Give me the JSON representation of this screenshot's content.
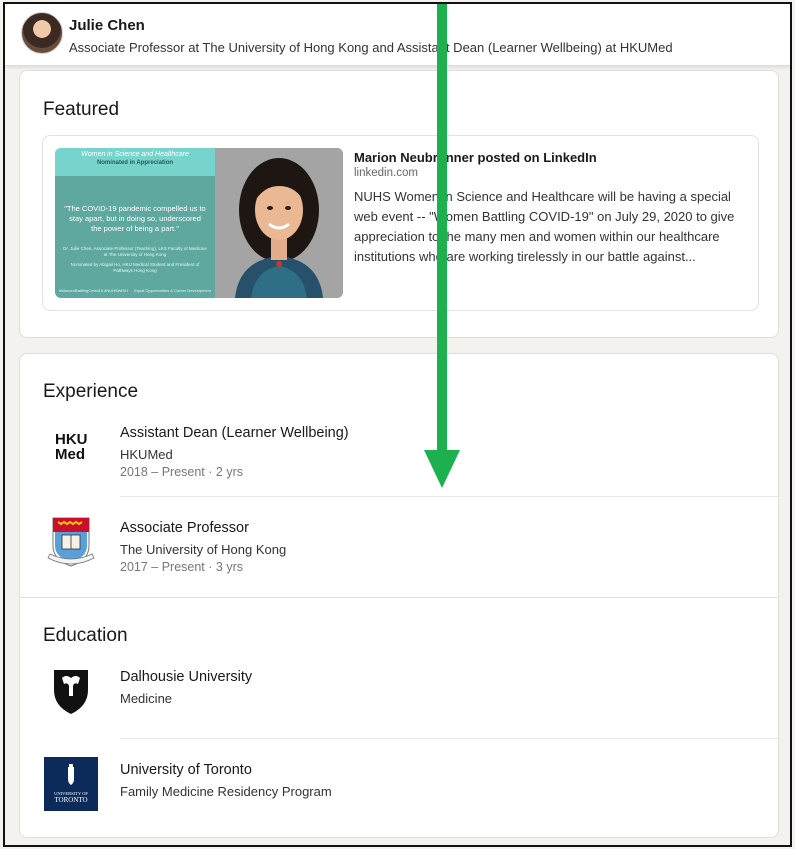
{
  "header": {
    "name": "Julie Chen",
    "headline": "Associate Professor at The University of Hong Kong and Assistant Dean (Learner Wellbeing) at HKUMed"
  },
  "featured": {
    "title": "Featured",
    "item": {
      "image_title": "Women in Science and Healthcare",
      "image_subtitle": "Nominated in Appreciation",
      "image_quote": "\"The COVID-19 pandemic compelled us to stay apart, but in doing so, underscored the power of being a part.\"",
      "image_credit": "Dr. Julie Chen, Associate Professor (Teaching), LKS Faculty of Medicine at The University of Hong Kong",
      "image_nominated": "Nominated by Abigail Ho, HKU Medical Student and President of Pathways Hong Kong",
      "image_tags": "#WomenBattlingCovid19 #NUHSWiSH",
      "image_eo": "Equal Opportunities & Career Development",
      "author_line": "Marion Neubronner posted on LinkedIn",
      "domain": "linkedin.com",
      "description": "NUHS Women in Science and Healthcare will be having a special web event -- \"Women Battling COVID-19\" on July 29, 2020 to give appreciation to the many men and women within our healthcare institutions who are working tirelessly in our battle against..."
    }
  },
  "experience": {
    "title": "Experience",
    "items": [
      {
        "title": "Assistant Dean (Learner Wellbeing)",
        "org": "HKUMed",
        "dates": "2018 – Present · 2 yrs",
        "logo": "hkumed-logo",
        "logo_text": [
          "HKU",
          "Med"
        ]
      },
      {
        "title": "Associate Professor",
        "org": "The University of Hong Kong",
        "dates": "2017 – Present · 3 yrs",
        "logo": "hku-crest-logo"
      }
    ]
  },
  "education": {
    "title": "Education",
    "items": [
      {
        "title": "Dalhousie University",
        "field": "Medicine",
        "logo": "dalhousie-shield-logo"
      },
      {
        "title": "University of Toronto",
        "field": "Family Medicine Residency Program",
        "logo": "uoft-logo",
        "logo_text": [
          "UNIVERSITY OF",
          "TORONTO"
        ]
      }
    ]
  },
  "colors": {
    "arrow": "#1db04e",
    "uoft_navy": "#0c2a5a",
    "hku_red": "#c8102e"
  }
}
